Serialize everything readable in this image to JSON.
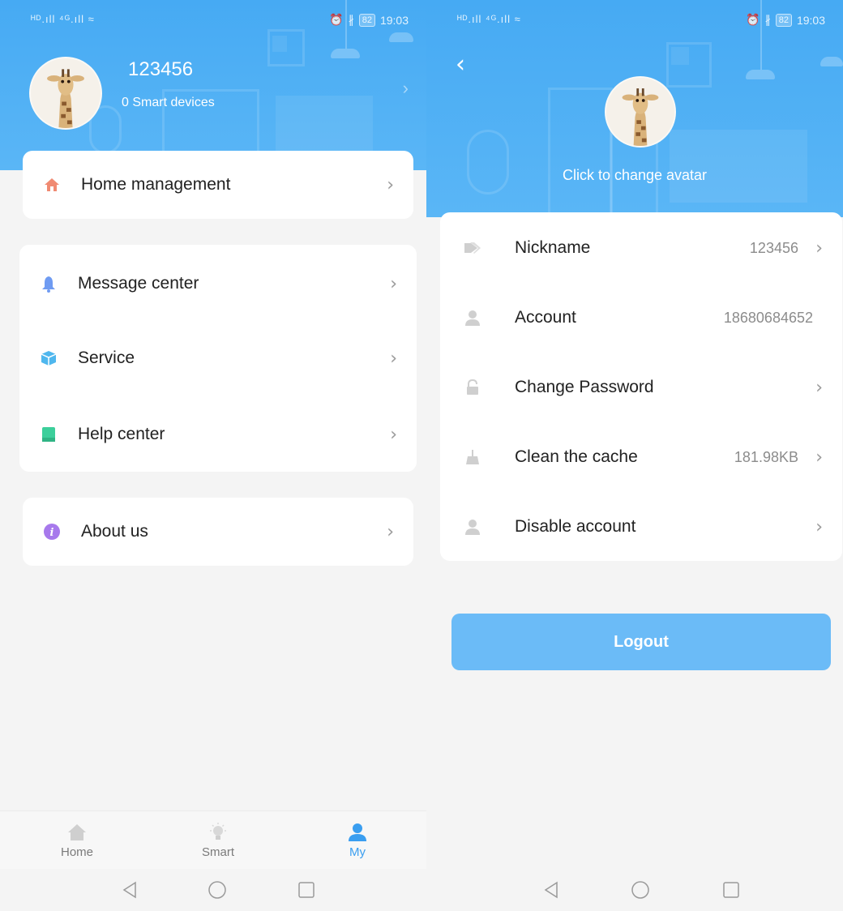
{
  "status_left": {
    "signal": "ᴴᴰ.ıll ⁴ᴳ.ıll ≈",
    "battery": "82",
    "time": "19:03"
  },
  "status_right": {
    "signal": "ᴴᴰ.ıll ⁴ᴳ.ıll ≈",
    "battery": "82",
    "time": "19:03"
  },
  "profile": {
    "username": "123456",
    "devices": "0 Smart devices"
  },
  "menu_primary": [
    {
      "label": "Home management",
      "icon": "home-icon",
      "color": "#f08a72"
    }
  ],
  "menu_secondary": [
    {
      "label": "Message center",
      "icon": "bell-icon",
      "color": "#6f9bf2"
    },
    {
      "label": "Service",
      "icon": "box-icon",
      "color": "#4fb7ee"
    },
    {
      "label": "Help center",
      "icon": "book-icon",
      "color": "#3ccf9b"
    }
  ],
  "menu_about": [
    {
      "label": "About us",
      "icon": "info-icon",
      "color": "#a779ec"
    }
  ],
  "tabs": [
    {
      "label": "Home",
      "icon": "home-icon"
    },
    {
      "label": "Smart",
      "icon": "bulb-icon"
    },
    {
      "label": "My",
      "icon": "user-icon",
      "active": true
    }
  ],
  "account": {
    "change_avatar": "Click to change avatar",
    "rows": [
      {
        "label": "Nickname",
        "value": "123456",
        "icon": "tag-icon"
      },
      {
        "label": "Account",
        "value": "18680684652",
        "icon": "person-icon"
      },
      {
        "label": "Change Password",
        "value": "",
        "icon": "lock-icon"
      },
      {
        "label": "Clean the cache",
        "value": "181.98KB",
        "icon": "broom-icon"
      },
      {
        "label": "Disable account",
        "value": "",
        "icon": "person-icon"
      }
    ],
    "logout": "Logout"
  },
  "colors": {
    "accent": "#3a9ef0",
    "header": "#4fb0f5",
    "logout": "#6bbbf7"
  }
}
